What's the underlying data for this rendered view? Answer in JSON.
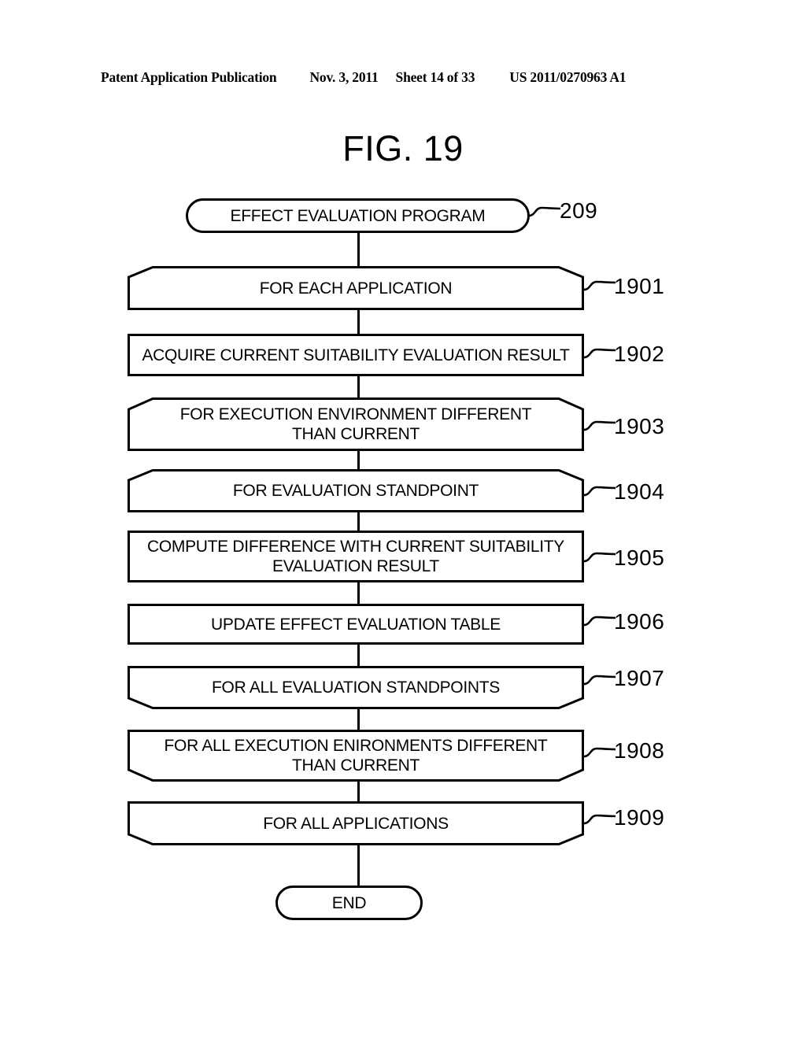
{
  "header": {
    "publication": "Patent Application Publication",
    "date": "Nov. 3, 2011",
    "sheet": "Sheet 14 of 33",
    "patent_number": "US 2011/0270963 A1"
  },
  "figure": {
    "title": "FIG. 19"
  },
  "flowchart": {
    "nodes": [
      {
        "id": "start",
        "shape": "terminator",
        "label": "EFFECT EVALUATION PROGRAM",
        "ref": "209"
      },
      {
        "id": "step-1901",
        "shape": "loop-start",
        "label": "FOR EACH APPLICATION",
        "ref": "1901"
      },
      {
        "id": "step-1902",
        "shape": "process",
        "label": "ACQUIRE CURRENT SUITABILITY EVALUATION RESULT",
        "ref": "1902"
      },
      {
        "id": "step-1903",
        "shape": "loop-start",
        "label": "FOR EXECUTION ENVIRONMENT DIFFERENT\nTHAN CURRENT",
        "ref": "1903"
      },
      {
        "id": "step-1904",
        "shape": "loop-start",
        "label": "FOR EVALUATION STANDPOINT",
        "ref": "1904"
      },
      {
        "id": "step-1905",
        "shape": "process",
        "label": "COMPUTE DIFFERENCE WITH CURRENT SUITABILITY\nEVALUATION RESULT",
        "ref": "1905"
      },
      {
        "id": "step-1906",
        "shape": "process",
        "label": "UPDATE EFFECT EVALUATION TABLE",
        "ref": "1906"
      },
      {
        "id": "step-1907",
        "shape": "loop-end",
        "label": "FOR ALL EVALUATION STANDPOINTS",
        "ref": "1907"
      },
      {
        "id": "step-1908",
        "shape": "loop-end",
        "label": "FOR ALL EXECUTION ENIRONMENTS DIFFERENT\nTHAN CURRENT",
        "ref": "1908"
      },
      {
        "id": "step-1909",
        "shape": "loop-end",
        "label": "FOR ALL APPLICATIONS",
        "ref": "1909"
      },
      {
        "id": "end",
        "shape": "terminator",
        "label": "END",
        "ref": ""
      }
    ]
  },
  "style": {
    "ink": "#000000",
    "paper": "#ffffff"
  }
}
